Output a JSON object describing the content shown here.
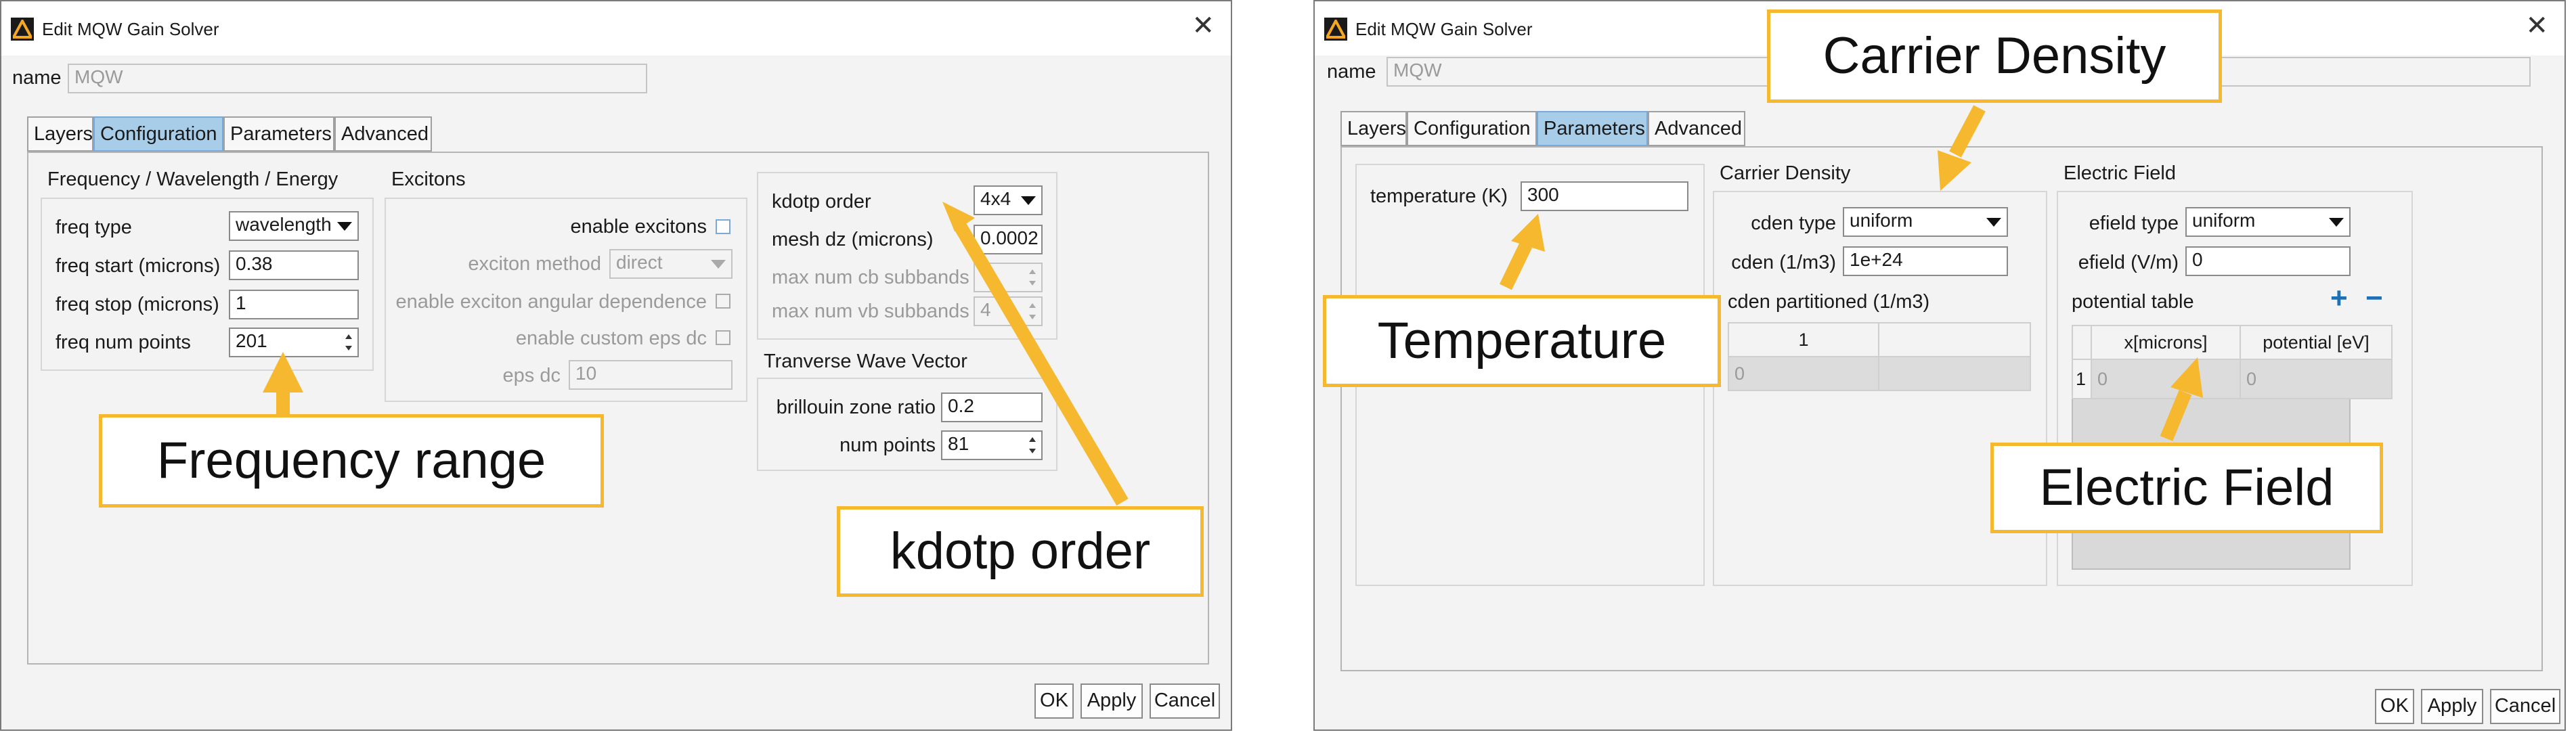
{
  "dialogs": [
    {
      "title": "Edit MQW Gain Solver",
      "name_label": "name",
      "name_value": "MQW",
      "tabs": [
        "Layers",
        "Configuration",
        "Parameters",
        "Advanced"
      ],
      "active_tab": "Configuration",
      "freq_group": {
        "title": "Frequency / Wavelength / Energy",
        "type_label": "freq type",
        "type_value": "wavelength",
        "start_label": "freq start (microns)",
        "start_value": "0.38",
        "stop_label": "freq stop (microns)",
        "stop_value": "1",
        "points_label": "freq num points",
        "points_value": "201"
      },
      "exciton_group": {
        "title": "Excitons",
        "enable_label": "enable excitons",
        "method_label": "exciton method",
        "method_value": "direct",
        "angular_label": "enable exciton angular dependence",
        "custom_eps_label": "enable custom eps dc",
        "eps_label": "eps dc",
        "eps_value": "10"
      },
      "kdotp_group": {
        "order_label": "kdotp order",
        "order_value": "4x4",
        "mesh_label": "mesh dz (microns)",
        "mesh_value": "0.0002",
        "cb_label": "max num cb subbands",
        "cb_value": "",
        "vb_label": "max num vb subbands",
        "vb_value": "4"
      },
      "wave_group": {
        "title": "Tranverse Wave Vector",
        "ratio_label": "brillouin zone ratio",
        "ratio_value": "0.2",
        "points_label": "num points",
        "points_value": "81"
      },
      "buttons": {
        "ok": "OK",
        "apply": "Apply",
        "cancel": "Cancel"
      }
    },
    {
      "title": "Edit MQW Gain Solver",
      "name_label": "name",
      "name_value": "MQW",
      "tabs": [
        "Layers",
        "Configuration",
        "Parameters",
        "Advanced"
      ],
      "active_tab": "Parameters",
      "temperature": {
        "label": "temperature (K)",
        "value": "300"
      },
      "carrier_group": {
        "title": "Carrier Density",
        "type_label": "cden type",
        "type_value": "uniform",
        "cden_label": "cden (1/m3)",
        "cden_value": "1e+24",
        "partitioned_label": "cden partitioned (1/m3)",
        "table_header": "1",
        "table_value": "0"
      },
      "efield_group": {
        "title": "Electric Field",
        "type_label": "efield type",
        "type_value": "uniform",
        "efield_label": "efield (V/m)",
        "efield_value": "0",
        "potential_label": "potential table",
        "add_symbol": "+",
        "remove_symbol": "−",
        "columns": [
          "x[microns]",
          "potential [eV]"
        ],
        "row_header": "1",
        "row_values": [
          "0",
          "0"
        ]
      },
      "buttons": {
        "ok": "OK",
        "apply": "Apply",
        "cancel": "Cancel"
      }
    }
  ],
  "annotations": {
    "frequency_range": "Frequency range",
    "kdotp_order": "kdotp order",
    "carrier_density": "Carrier Density",
    "temperature": "Temperature",
    "electric_field": "Electric Field"
  },
  "colors": {
    "annotation_border": "#f5b82e",
    "annotation_arrow": "#f5b82e",
    "active_tab": "#a8cde9",
    "add_icon": "#1f6fb5"
  }
}
